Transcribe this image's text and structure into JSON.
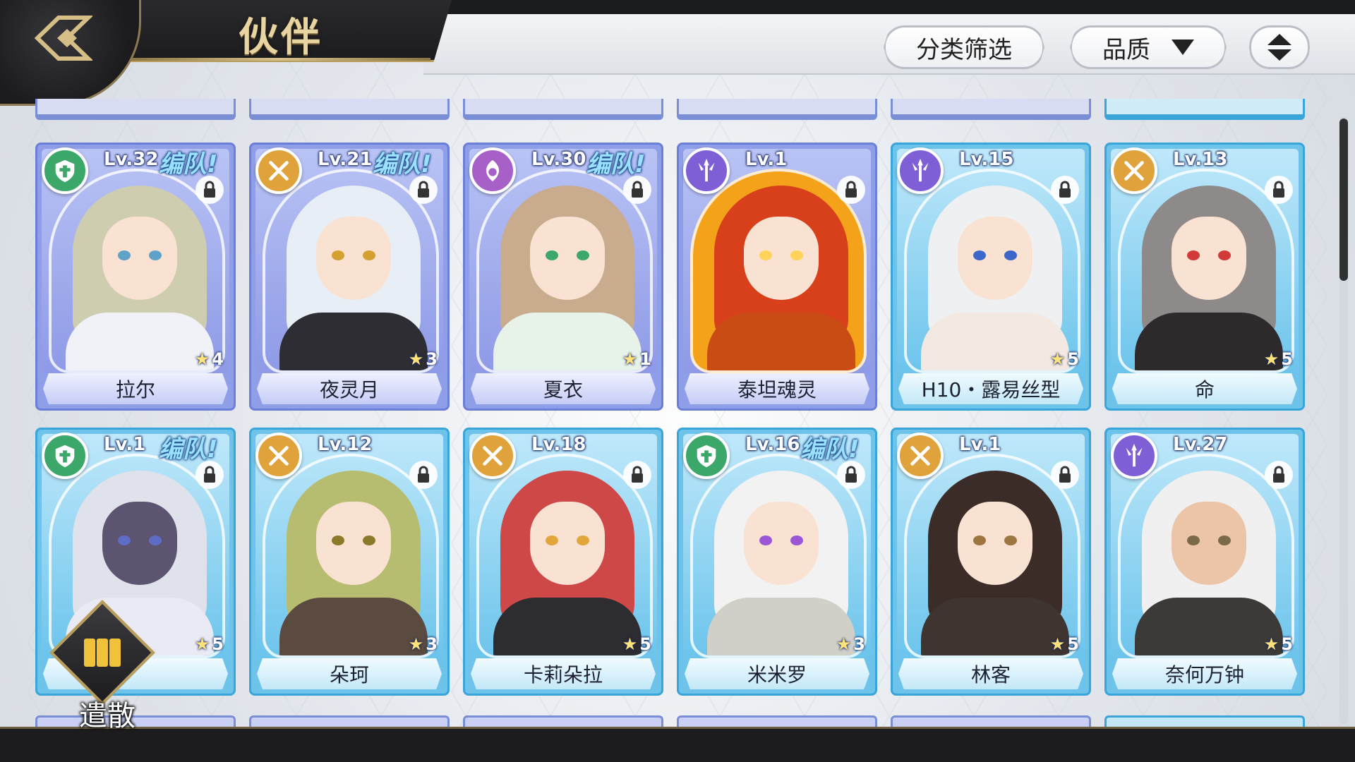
{
  "header": {
    "title": "伙伴",
    "filter_label": "分类筛选",
    "quality_label": "品质"
  },
  "colors": {
    "purple_card": "#8f9ee8",
    "blue_card": "#6ec3eb",
    "gold_accent": "#b99d5d",
    "team_text": "#9ae0ff"
  },
  "cards": [
    {
      "level": "Lv.32",
      "team": "编队!",
      "stars": "4",
      "name": "拉尔",
      "class": "shield-icon",
      "frame": "purple"
    },
    {
      "level": "Lv.21",
      "team": "编队!",
      "stars": "3",
      "name": "夜灵月",
      "class": "crossed-swords-icon",
      "frame": "purple"
    },
    {
      "level": "Lv.30",
      "team": "编队!",
      "stars": "1",
      "name": "夏衣",
      "class": "crescent-flame-icon",
      "frame": "purple"
    },
    {
      "level": "Lv.1",
      "team": "",
      "stars": "",
      "name": "泰坦魂灵",
      "class": "trident-icon",
      "frame": "purple"
    },
    {
      "level": "Lv.15",
      "team": "",
      "stars": "5",
      "name": "H10・露易丝型",
      "class": "trident-icon",
      "frame": "blue"
    },
    {
      "level": "Lv.13",
      "team": "",
      "stars": "5",
      "name": "命",
      "class": "crossed-swords-icon",
      "frame": "blue"
    },
    {
      "level": "Lv.1",
      "team": "编队!",
      "stars": "5",
      "name": "",
      "class": "shield-icon",
      "frame": "blue"
    },
    {
      "level": "Lv.12",
      "team": "",
      "stars": "3",
      "name": "朵珂",
      "class": "crossed-swords-icon",
      "frame": "blue"
    },
    {
      "level": "Lv.18",
      "team": "",
      "stars": "5",
      "name": "卡莉朵拉",
      "class": "crossed-swords-icon",
      "frame": "blue"
    },
    {
      "level": "Lv.16",
      "team": "编队!",
      "stars": "3",
      "name": "米米罗",
      "class": "shield-icon",
      "frame": "blue"
    },
    {
      "level": "Lv.1",
      "team": "",
      "stars": "5",
      "name": "林客",
      "class": "crossed-swords-icon",
      "frame": "blue"
    },
    {
      "level": "Lv.27",
      "team": "",
      "stars": "5",
      "name": "奈何万钟",
      "class": "trident-icon",
      "frame": "blue"
    }
  ],
  "dismiss": {
    "label": "遣散"
  }
}
